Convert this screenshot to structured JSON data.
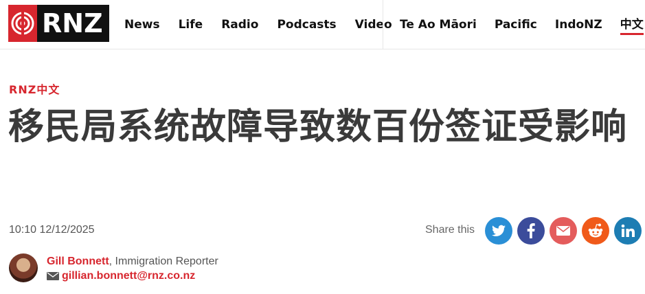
{
  "brand": {
    "logo_text": "RNZ",
    "accent": "#d7262e"
  },
  "nav": {
    "primary": [
      "News",
      "Life",
      "Radio",
      "Podcasts",
      "Video"
    ],
    "secondary": [
      "Te Ao Māori",
      "Pacific",
      "IndoNZ",
      "中文"
    ],
    "active": "中文"
  },
  "article": {
    "section": "RNZ中文",
    "headline": "移民局系统故障导致数百份签证受影响",
    "timestamp": "10:10 12/12/2025"
  },
  "share": {
    "label": "Share this",
    "buttons": [
      {
        "name": "twitter",
        "icon": "twitter-icon",
        "color": "#2a8fd6"
      },
      {
        "name": "facebook",
        "icon": "facebook-icon",
        "color": "#3b4c9b"
      },
      {
        "name": "email",
        "icon": "email-icon",
        "color": "#e45c5c"
      },
      {
        "name": "reddit",
        "icon": "reddit-icon",
        "color": "#f05a1a"
      },
      {
        "name": "linkedin",
        "icon": "linkedin-icon",
        "color": "#1d7db3"
      }
    ]
  },
  "author": {
    "name": "Gill Bonnett",
    "role": ", Immigration Reporter",
    "email": "gillian.bonnett@rnz.co.nz"
  }
}
